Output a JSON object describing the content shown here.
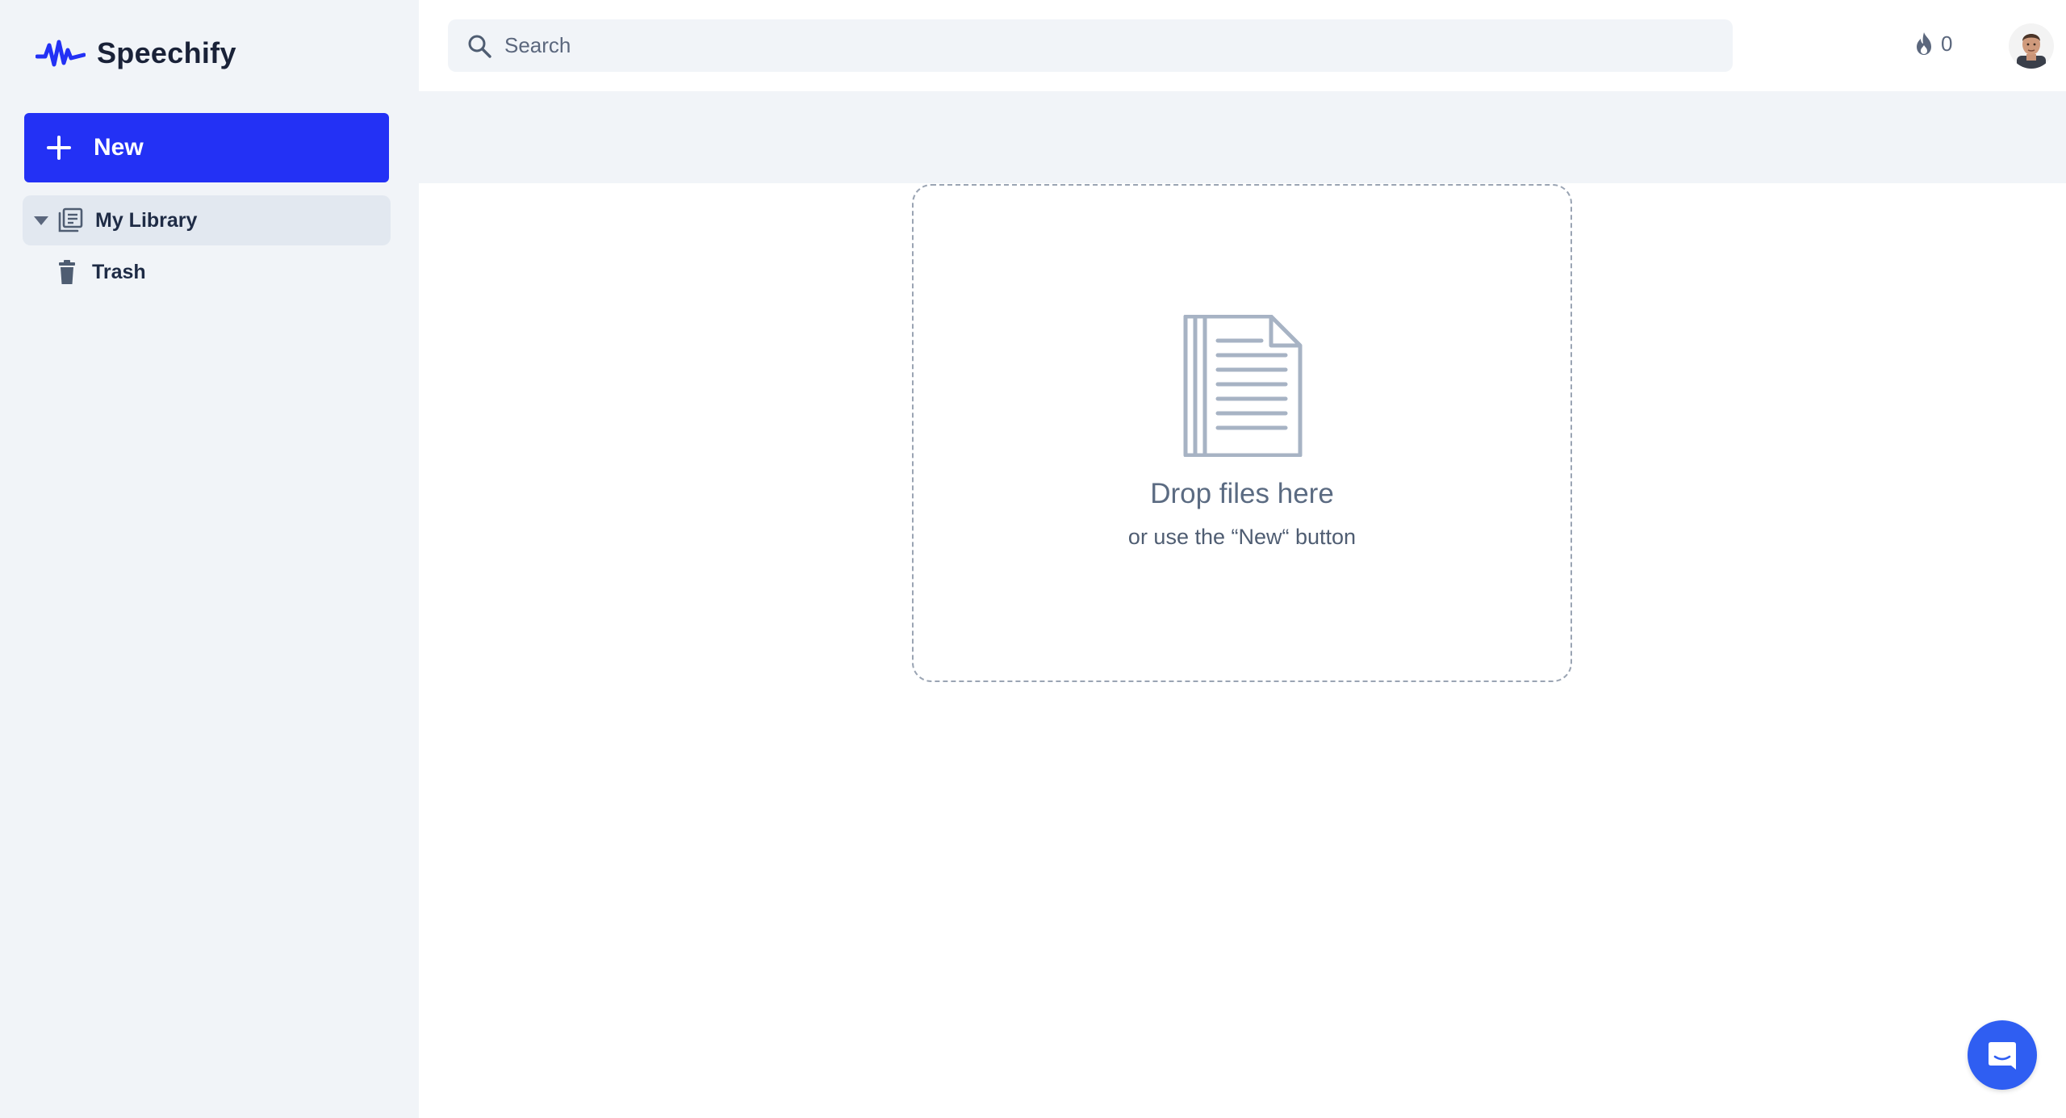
{
  "app": {
    "name": "Speechify",
    "brand_color": "#2331f5"
  },
  "sidebar": {
    "new_button": {
      "label": "New",
      "icon": "plus-icon"
    },
    "items": [
      {
        "label": "My Library",
        "icon": "library-icon",
        "active": true,
        "expanded": true
      },
      {
        "label": "Trash",
        "icon": "trash-icon",
        "active": false
      }
    ]
  },
  "header": {
    "search": {
      "placeholder": "Search",
      "value": "",
      "icon": "search-icon"
    },
    "streak": {
      "count": "0",
      "icon": "fire-icon"
    },
    "avatar": {
      "icon": "user-avatar"
    }
  },
  "dropzone": {
    "title": "Drop files here",
    "subtitle": "or use the “New“ button",
    "icon": "document-icon"
  },
  "chat": {
    "icon": "chat-bubble-icon",
    "color": "#2f5ef2"
  }
}
